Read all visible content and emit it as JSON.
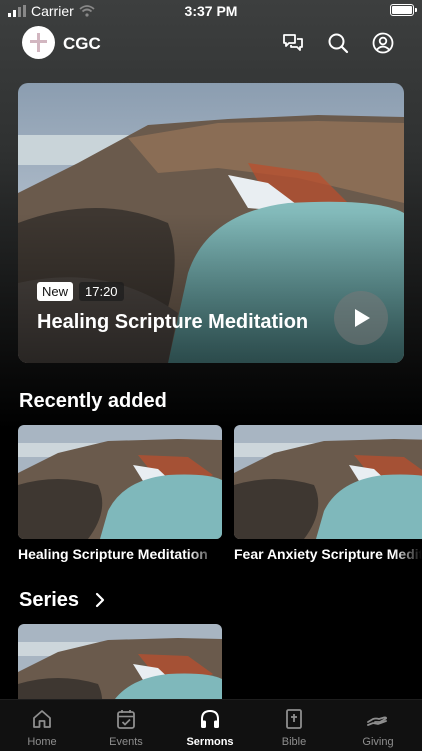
{
  "status_bar": {
    "carrier": "Carrier",
    "time": "3:37 PM"
  },
  "header": {
    "brand": "CGC"
  },
  "hero": {
    "badge": "New",
    "duration": "17:20",
    "title": "Healing Scripture Meditation"
  },
  "recently_added": {
    "title": "Recently added",
    "items": [
      {
        "title": "Healing Scripture Meditation"
      },
      {
        "title": "Fear Anxiety Scripture Meditation"
      }
    ]
  },
  "series": {
    "title": "Series"
  },
  "tabs": [
    {
      "label": "Home",
      "icon": "home-icon"
    },
    {
      "label": "Events",
      "icon": "calendar-check-icon"
    },
    {
      "label": "Sermons",
      "icon": "headphones-icon",
      "active": true
    },
    {
      "label": "Bible",
      "icon": "bible-icon"
    },
    {
      "label": "Giving",
      "icon": "giving-hand-icon"
    }
  ],
  "colors": {
    "background": "#000000",
    "tab_bar": "#111111",
    "active_tab": "#ffffff",
    "inactive_tab": "#8e8e8e"
  }
}
